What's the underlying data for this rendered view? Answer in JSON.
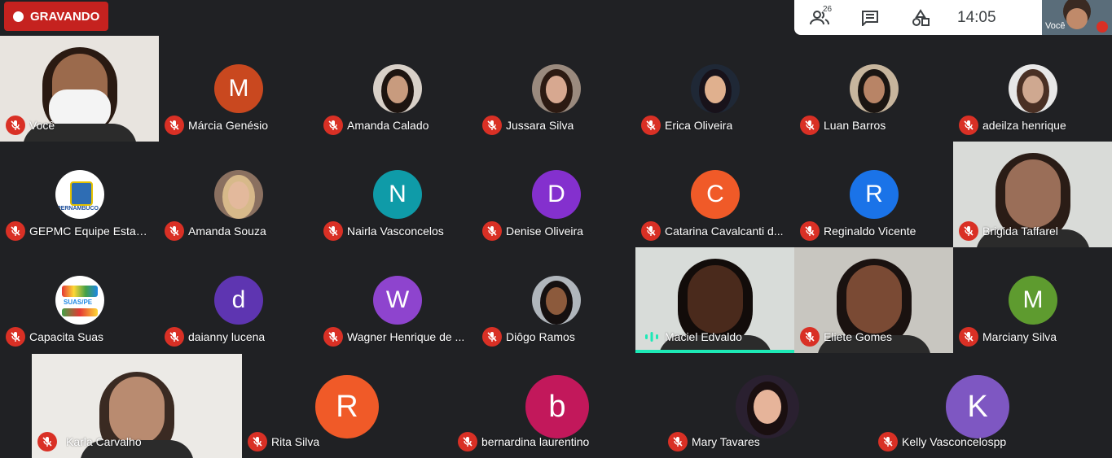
{
  "recording": {
    "label": "GRAVANDO"
  },
  "toolbar": {
    "participants_count": "26",
    "time": "14:05",
    "self_label": "Você"
  },
  "colors": {
    "recording_red": "#c5221f",
    "mic_red": "#d93025",
    "speaking_teal": "#1de9b6"
  },
  "participants": [
    {
      "name": "Você",
      "initial": ""
    },
    {
      "name": "Márcia Genésio",
      "initial": "M"
    },
    {
      "name": "Amanda Calado",
      "initial": ""
    },
    {
      "name": "Jussara Silva",
      "initial": ""
    },
    {
      "name": "Erica Oliveira",
      "initial": ""
    },
    {
      "name": "Luan Barros",
      "initial": ""
    },
    {
      "name": "adeilza henrique",
      "initial": ""
    },
    {
      "name": "GEPMC Equipe Estad...",
      "initial": ""
    },
    {
      "name": "Amanda Souza",
      "initial": ""
    },
    {
      "name": "Nairla Vasconcelos",
      "initial": "N"
    },
    {
      "name": "Denise Oliveira",
      "initial": "D"
    },
    {
      "name": "Catarina Cavalcanti d...",
      "initial": "C"
    },
    {
      "name": "Reginaldo Vicente",
      "initial": "R"
    },
    {
      "name": "Brigida Taffarel",
      "initial": ""
    },
    {
      "name": "Capacita Suas",
      "initial": ""
    },
    {
      "name": "daianny lucena",
      "initial": "d"
    },
    {
      "name": "Wagner Henrique de ...",
      "initial": "W"
    },
    {
      "name": "Diôgo Ramos",
      "initial": ""
    },
    {
      "name": "Maciel Edvaldo",
      "initial": ""
    },
    {
      "name": "Eliete Gomes",
      "initial": ""
    },
    {
      "name": "Marciany Silva",
      "initial": "M"
    },
    {
      "name": "Karla Carvalho",
      "initial": ""
    },
    {
      "name": "Rita Silva",
      "initial": "R"
    },
    {
      "name": "bernardina laurentino",
      "initial": "b"
    },
    {
      "name": "Mary Tavares",
      "initial": ""
    },
    {
      "name": "Kelly Vasconcelospp",
      "initial": "K"
    }
  ],
  "logos": {
    "pernambuco": "PERNAMBUCO",
    "capacita": "SUAS/PE"
  }
}
